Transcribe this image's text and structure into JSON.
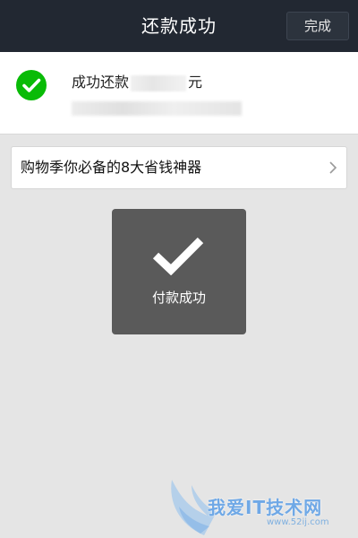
{
  "header": {
    "title": "还款成功",
    "done_label": "完成"
  },
  "result": {
    "prefix": "成功还款",
    "suffix": "元",
    "status_color": "#09bb07"
  },
  "promo": {
    "label": "购物季你必备的8大省钱神器"
  },
  "toast": {
    "message": "付款成功"
  },
  "watermark": {
    "brand": "我爱IT技术网",
    "url": "www.52ij.com"
  }
}
